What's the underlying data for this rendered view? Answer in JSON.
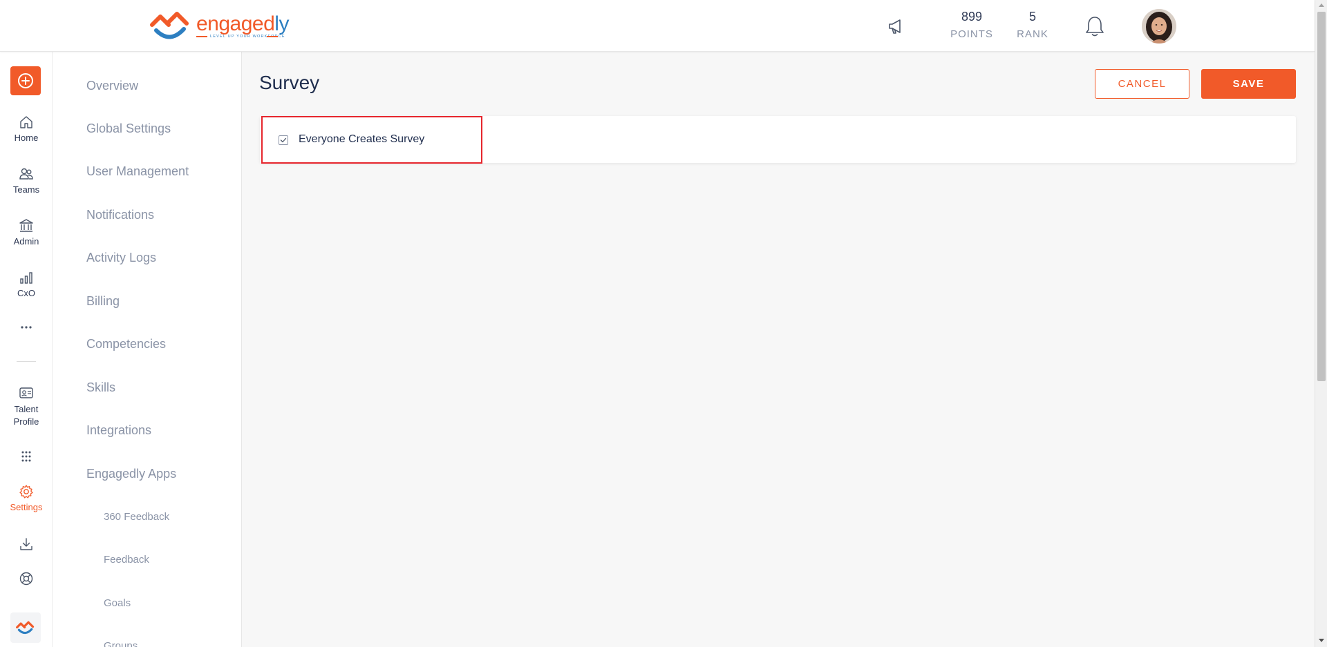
{
  "header": {
    "logo": {
      "brand_main": "engaged",
      "brand_accent": "ly",
      "tagline": "LEVEL UP YOUR WORKFORCE"
    },
    "points": {
      "value": "899",
      "label": "POINTS"
    },
    "rank": {
      "value": "5",
      "label": "RANK"
    },
    "icons": [
      "megaphone-icon",
      "bell-icon"
    ]
  },
  "rail": {
    "items": [
      {
        "label": "Home",
        "icon": "home-icon"
      },
      {
        "label": "Teams",
        "icon": "teams-icon"
      },
      {
        "label": "Admin",
        "icon": "admin-icon"
      },
      {
        "label": "CxO",
        "icon": "chart-icon"
      },
      {
        "label": "Talent Profile",
        "icon": "id-card-icon"
      },
      {
        "label": "Settings",
        "icon": "gear-icon",
        "active": true
      }
    ],
    "accent_color": "#f15a29"
  },
  "subnav": {
    "items": [
      "Overview",
      "Global Settings",
      "User Management",
      "Notifications",
      "Activity Logs",
      "Billing",
      "Competencies",
      "Skills",
      "Integrations",
      "Engagedly Apps"
    ],
    "subitems": [
      "360 Feedback",
      "Feedback",
      "Goals",
      "Groups"
    ]
  },
  "main": {
    "title": "Survey",
    "cancel_label": "CANCEL",
    "save_label": "SAVE",
    "option": {
      "label": "Everyone Creates Survey",
      "checked": true
    },
    "highlight_color": "#e6262d"
  }
}
